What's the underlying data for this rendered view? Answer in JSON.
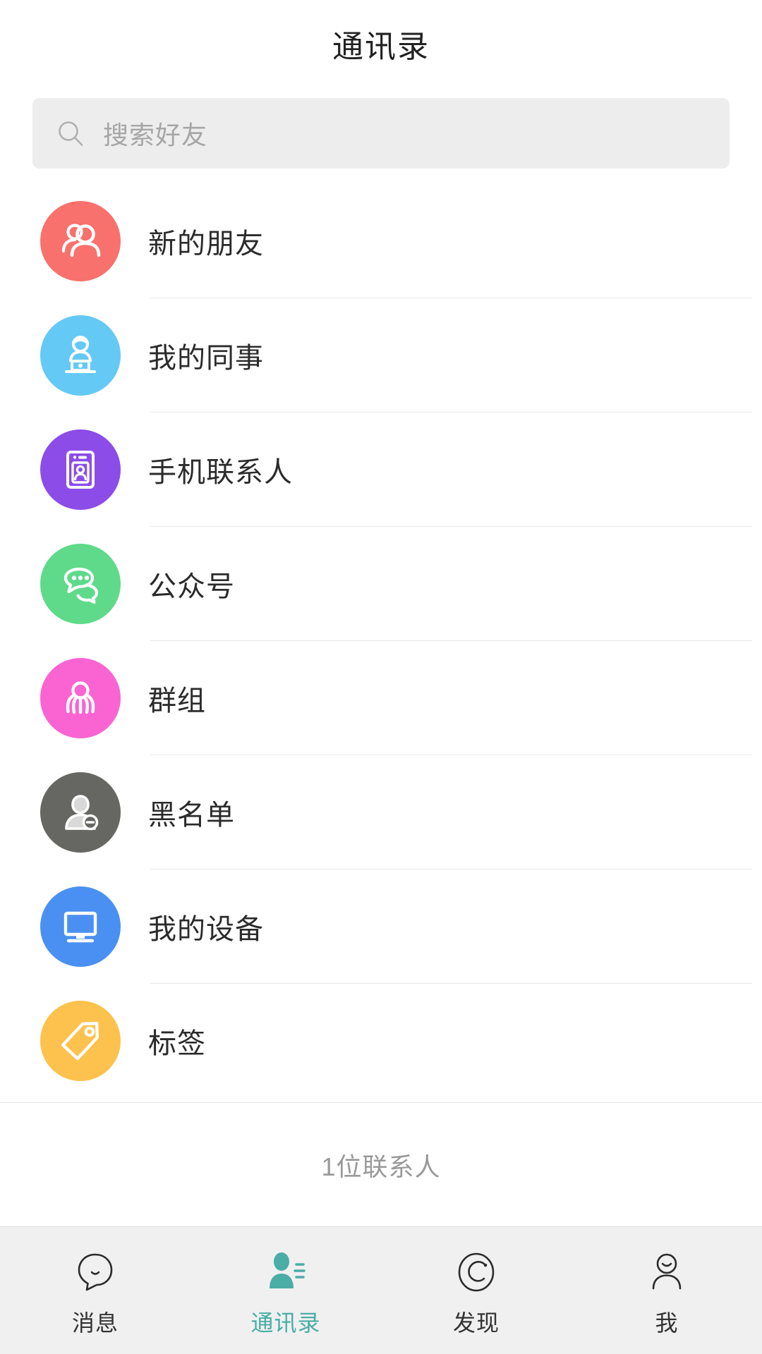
{
  "header": {
    "title": "通讯录"
  },
  "search": {
    "placeholder": "搜索好友",
    "icon": "search-icon"
  },
  "list": {
    "items": [
      {
        "label": "新的朋友",
        "icon": "new-friends-icon",
        "color": "#f8716d"
      },
      {
        "label": "我的同事",
        "icon": "colleagues-icon",
        "color": "#65c9f5"
      },
      {
        "label": "手机联系人",
        "icon": "phone-contacts-icon",
        "color": "#8b4ce8"
      },
      {
        "label": "公众号",
        "icon": "official-account-icon",
        "color": "#5fda8b"
      },
      {
        "label": "群组",
        "icon": "groups-icon",
        "color": "#f964d2"
      },
      {
        "label": "黑名单",
        "icon": "blacklist-icon",
        "color": "#666663"
      },
      {
        "label": "我的设备",
        "icon": "my-devices-icon",
        "color": "#4a90f2"
      },
      {
        "label": "标签",
        "icon": "tags-icon",
        "color": "#fcc martial"
      }
    ]
  },
  "footer": {
    "count_text": "1位联系人"
  },
  "tabbar": {
    "active_color": "#4aada6",
    "items": [
      {
        "label": "消息",
        "icon": "chat-bubble-icon",
        "active": false
      },
      {
        "label": "通讯录",
        "icon": "contacts-icon",
        "active": true
      },
      {
        "label": "发现",
        "icon": "discover-icon",
        "active": false
      },
      {
        "label": "我",
        "icon": "profile-icon",
        "active": false
      }
    ]
  }
}
